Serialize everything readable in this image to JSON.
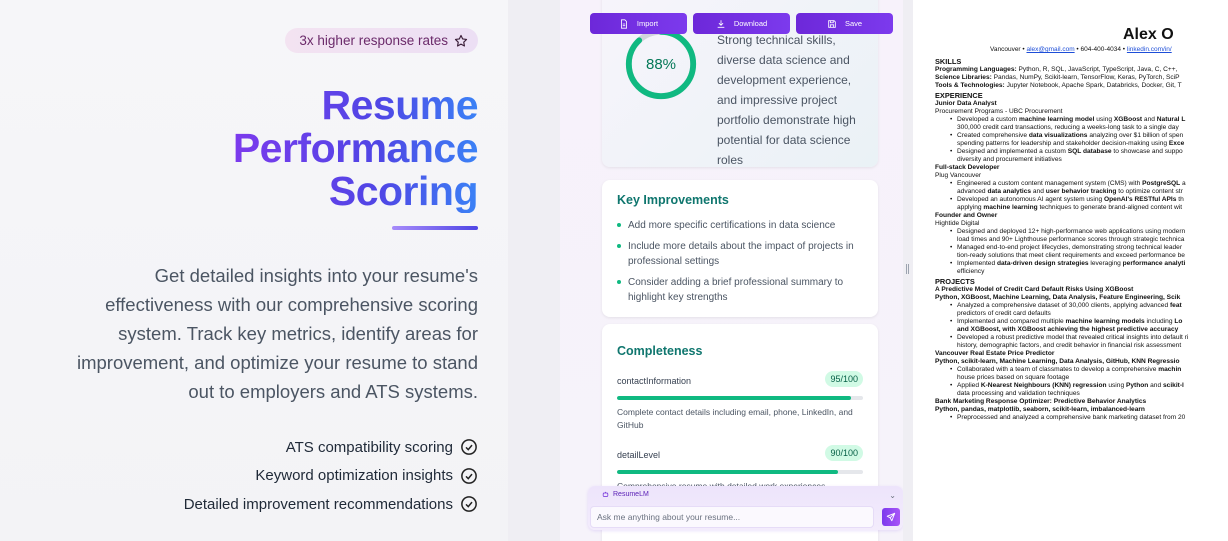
{
  "marketing": {
    "badge": "3x higher response rates",
    "headline": [
      "Resume",
      "Performance",
      "Scoring"
    ],
    "description": "Get detailed insights into your resume's effectiveness with our comprehensive scoring system. Track key metrics, identify areas for improvement, and optimize your resume to stand out to employers and ATS systems.",
    "features": [
      "ATS compatibility scoring",
      "Keyword optimization insights",
      "Detailed improvement recommendations"
    ]
  },
  "toolbar": {
    "import_label": "Import",
    "download_label": "Download",
    "save_label": "Save"
  },
  "score": {
    "value_label": "88%",
    "progress": 0.88,
    "summary": "Strong technical skills, diverse data science and development experience, and impressive project portfolio demonstrate high potential for data science roles"
  },
  "improvements": {
    "title": "Key Improvements",
    "items": [
      "Add more specific certifications in data science",
      "Include more details about the impact of projects in professional settings",
      "Consider adding a brief professional summary to highlight key strengths"
    ]
  },
  "completeness": {
    "title": "Completeness",
    "metrics": [
      {
        "name": "contactInformation",
        "score": "95/100",
        "fraction": 0.95,
        "description": "Complete contact details including email, phone, LinkedIn, and GitHub"
      },
      {
        "name": "detailLevel",
        "score": "90/100",
        "fraction": 0.9,
        "description": "Comprehensive resume with detailed work experiences"
      }
    ]
  },
  "chat": {
    "title": "ResumeLM",
    "placeholder": "Ask me anything about your resume..."
  },
  "colors": {
    "accent": "#7c3aed",
    "accent_blue": "#4f46e5",
    "success": "#10b981",
    "teal_heading": "#0f766e"
  },
  "resume": {
    "name": "Alex O",
    "contact_city": "Vancouver",
    "contact_email": "alex@gmail.com",
    "contact_phone": "604-400-4034",
    "contact_linkedin": "linkedin.com/in/",
    "skills_heading": "SKILLS",
    "skills": [
      {
        "label": "Programming Languages:",
        "value": " Python, R, SQL, JavaScript, TypeScript, Java, C, C++,"
      },
      {
        "label": "Science Libraries:",
        "value": " Pandas, NumPy, Scikit-learn, TensorFlow, Keras, PyTorch, SciP"
      },
      {
        "label": "Tools & Technologies:",
        "value": " Jupyter Notebook, Apache Spark, Databricks, Docker, Git, T"
      }
    ],
    "experience_heading": "EXPERIENCE",
    "jobs": [
      {
        "title": "Junior Data Analyst",
        "company": "Procurement Programs - UBC Procurement",
        "bullets": [
          [
            "Developed a custom ",
            "machine learning model",
            " using ",
            "XGBoost",
            " and ",
            "Natural L"
          ],
          [
            "300,000 credit card transactions, reducing a weeks-long task to a single day"
          ],
          [
            "Created comprehensive ",
            "data visualizations",
            " analyzing over $1 billion of spen"
          ],
          [
            "spending patterns for leadership and stakeholder decision-making using ",
            "Exce"
          ],
          [
            "Designed and implemented a custom ",
            "SQL database",
            " to showcase and suppo"
          ],
          [
            "diversity and procurement initiatives"
          ]
        ]
      },
      {
        "title": "Full-stack Developer",
        "company": "Plug Vancouver",
        "bullets": [
          [
            "Engineered a custom content management system (CMS) with ",
            "PostgreSQL",
            " a"
          ],
          [
            "advanced ",
            "data analytics",
            " and ",
            "user behavior tracking",
            " to optimize content str"
          ],
          [
            "Developed an autonomous AI agent system using ",
            "OpenAI's RESTful APIs",
            " th"
          ],
          [
            "applying ",
            "machine learning",
            " techniques to generate brand-aligned content wit"
          ]
        ]
      },
      {
        "title": "Founder and Owner",
        "company": "Hightide Digital",
        "bullets": [
          [
            "Designed and deployed 12+ high-performance web applications using modern"
          ],
          [
            "load times and 90+ Lighthouse performance scores through strategic technica"
          ],
          [
            "Managed end-to-end project lifecycles, demonstrating strong technical leader"
          ],
          [
            "tion-ready solutions that meet client requirements and exceed performance be"
          ],
          [
            "Implemented ",
            "data-driven design strategies",
            " leveraging ",
            "performance analyti"
          ],
          [
            "efficiency"
          ]
        ]
      }
    ],
    "projects_heading": "PROJECTS",
    "projects": [
      {
        "title": "A Predictive Model of Credit Card Default Risks Using XGBoost",
        "stack": "Python, XGBoost, Machine Learning, Data Analysis, Feature Engineering, Scik",
        "bullets": [
          [
            "Analyzed a comprehensive dataset of 30,000 clients, applying advanced ",
            "feat"
          ],
          [
            "predictors of credit card defaults"
          ],
          [
            "Implemented and compared multiple ",
            "machine learning models",
            " including ",
            "Lo"
          ],
          [
            "and XGBoost",
            ", with XGBoost achieving the highest predictive accuracy"
          ],
          [
            "Developed a robust predictive model that revealed critical insights into default ri"
          ],
          [
            "history, demographic factors, and credit behavior in financial risk assessment"
          ]
        ]
      },
      {
        "title": "Vancouver Real Estate Price Predictor",
        "stack": "Python, scikit-learn, Machine Learning, Data Analysis, GitHub, KNN Regressio",
        "bullets": [
          [
            "Collaborated with a team of classmates to develop a comprehensive ",
            "machin"
          ],
          [
            "house prices based on square footage"
          ],
          [
            "Applied ",
            "K-Nearest Neighbours (KNN) regression",
            " using ",
            "Python",
            " and ",
            "scikit-l"
          ],
          [
            "data processing and validation techniques"
          ]
        ]
      },
      {
        "title": "Bank Marketing Response Optimizer: Predictive Behavior Analytics",
        "stack": "Python, pandas, matplotlib, seaborn, scikit-learn, imbalanced-learn",
        "bullets": [
          [
            "Preprocessed and analyzed a comprehensive bank marketing dataset from 20"
          ]
        ]
      }
    ]
  }
}
